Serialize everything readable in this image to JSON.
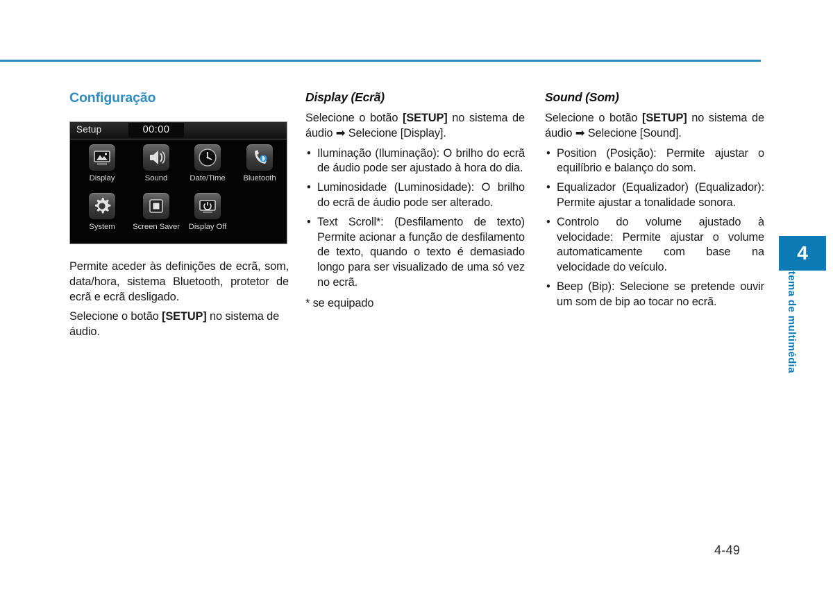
{
  "page": {
    "number": "4-49",
    "accent_color": "#2e8dc0",
    "tab_color": "#0b7ab5"
  },
  "chapter_tab": {
    "number": "4",
    "name": "Sistema de multimédia"
  },
  "left_column": {
    "title": "Configuração",
    "head_unit": {
      "title": "Setup",
      "clock": "00:00",
      "items": [
        {
          "label": "Display",
          "icon": "picture-icon"
        },
        {
          "label": "Sound",
          "icon": "speaker-icon"
        },
        {
          "label": "Date/Time",
          "icon": "clock-icon"
        },
        {
          "label": "Bluetooth",
          "icon": "bluetooth-handset-icon"
        },
        {
          "label": "System",
          "icon": "gear-icon"
        },
        {
          "label": "Screen Saver",
          "icon": "screen-saver-icon"
        },
        {
          "label": "Display Off",
          "icon": "display-off-icon"
        }
      ]
    },
    "paragraph_1": "Permite aceder às definições de ecrã, som, data/hora, sistema Bluetooth, protetor de ecrã e ecrã desligado.",
    "paragraph_2_part1": "Selecione o botão ",
    "paragraph_2_kbd": "[SETUP]",
    "paragraph_2_part2": " no sistema de áudio."
  },
  "middle_column": {
    "title": "Display (Ecrã)",
    "intro_part1": "Selecione o botão ",
    "intro_kbd": "[SETUP]",
    "intro_part2": " no sistema de áudio ",
    "intro_arrow": "➡",
    "intro_part3": " Selecione [Display].",
    "bullets": [
      "Iluminação (Iluminação): O brilho do ecrã de áudio pode ser ajustado à hora do dia.",
      "Luminosidade (Luminosidade): O brilho do ecrã de áudio pode ser alterado.",
      "Text Scroll*: (Desfilamento de texto) Permite acionar a função de desfilamento de texto, quando o texto é demasiado longo para ser visualizado de uma só vez no ecrã."
    ],
    "footnote": "* se equipado"
  },
  "right_column": {
    "title": "Sound (Som)",
    "intro_part1": "Selecione o botão ",
    "intro_kbd": "[SETUP]",
    "intro_part2": " no sistema de áudio ",
    "intro_arrow": "➡",
    "intro_part3": " Selecione [Sound].",
    "bullets": [
      "Position (Posição): Permite ajustar o equilíbrio e balanço do som.",
      "Equalizador                    (Equalizador) (Equalizador): Permite ajustar a tonalidade sonora.",
      "Controlo do volume ajustado à velocidade: Permite ajustar o volume automaticamente com base na velocidade do veículo.",
      "Beep (Bip): Selecione se pretende ouvir um som de bip ao tocar no ecrã."
    ]
  },
  "bullet_glyph": "•"
}
